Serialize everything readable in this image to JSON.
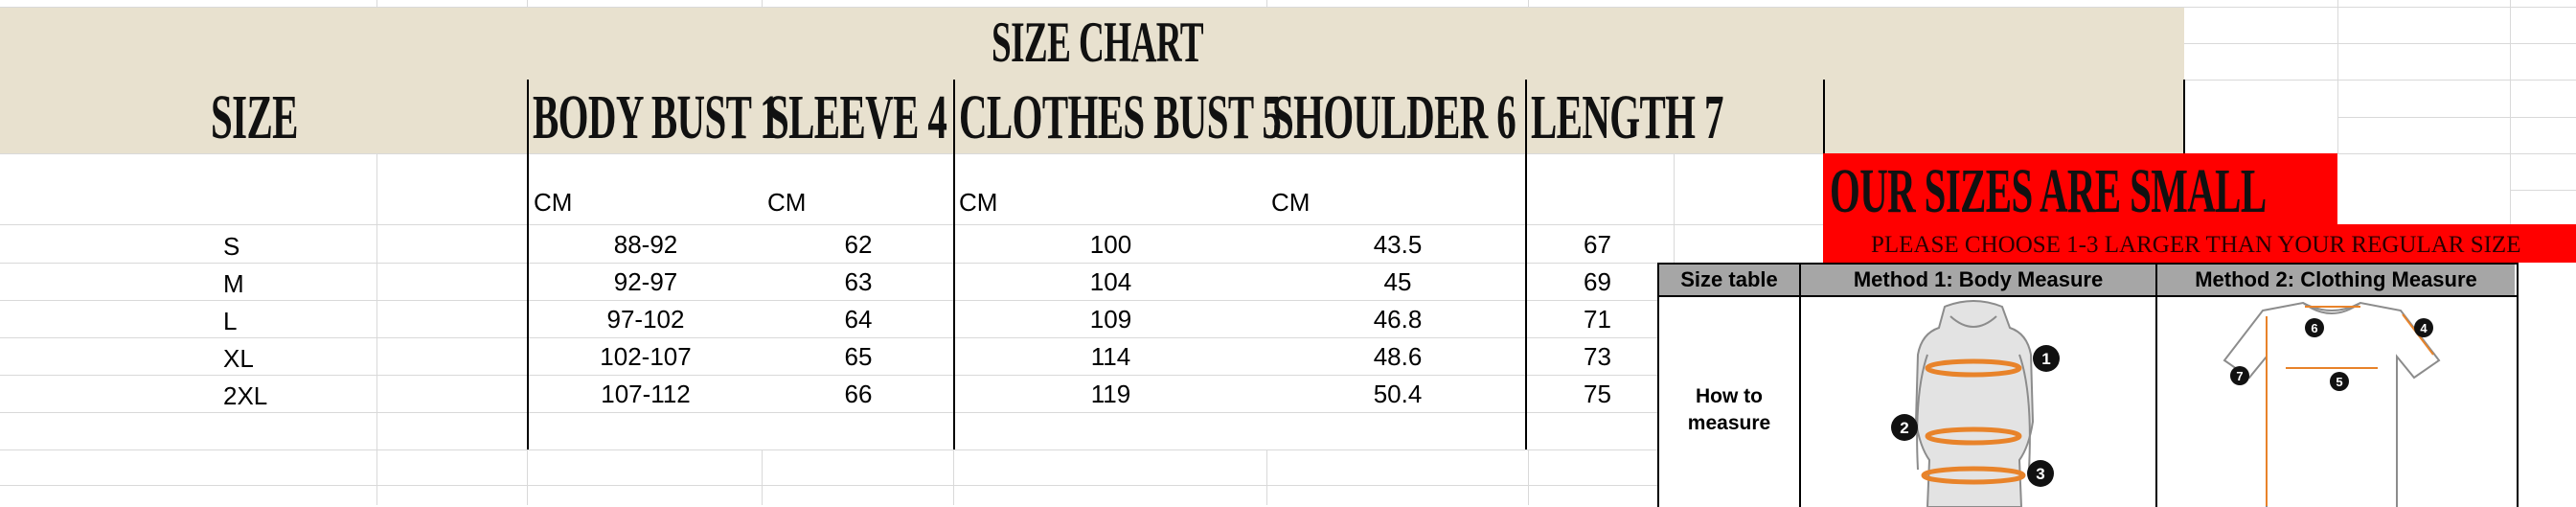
{
  "chart_data": {
    "type": "table",
    "title": "SIZE CHART",
    "columns": [
      "SIZE",
      "BODY BUST 1",
      "SLEEVE 4",
      "CLOTHES BUST 5",
      "SHOULDER 6",
      "LENGTH 7"
    ],
    "units": [
      "",
      "CM",
      "CM",
      "CM",
      "CM",
      ""
    ],
    "rows": [
      [
        "S",
        "88-92",
        "62",
        "100",
        "43.5",
        "67"
      ],
      [
        "M",
        "92-97",
        "63",
        "104",
        "45",
        "69"
      ],
      [
        "L",
        "97-102",
        "64",
        "109",
        "46.8",
        "71"
      ],
      [
        "XL",
        "102-107",
        "65",
        "114",
        "48.6",
        "73"
      ],
      [
        "2XL",
        "107-112",
        "66",
        "119",
        "50.4",
        "75"
      ]
    ]
  },
  "notice": {
    "headline": "OUR SIZES ARE SMALL",
    "subline": "PLEASE CHOOSE 1-3 LARGER  THAN YOUR REGULAR SIZE",
    "color": "#ff0000"
  },
  "measure_guide": {
    "col1": "Size table",
    "col2": "Method 1: Body  Measure",
    "col3": "Method 2: Clothing Measure",
    "how_line1": "How to",
    "how_line2": "measure",
    "body_markers": [
      "1",
      "2",
      "3"
    ],
    "shirt_markers": [
      "6",
      "4",
      "7",
      "5"
    ],
    "accent": "#e8832a"
  },
  "colors": {
    "header_bg": "#e8e1cf",
    "red": "#ff0000",
    "gray": "#a6a6a6"
  }
}
